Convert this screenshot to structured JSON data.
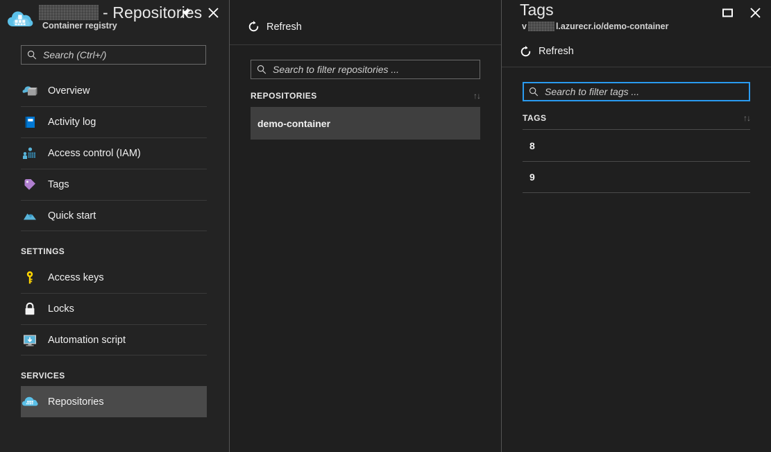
{
  "blade_menu": {
    "resource_icon": "container-registry-cloud-icon",
    "title_redacted": true,
    "title_suffix": "- Repositories",
    "subtitle": "Container registry",
    "actions": [
      {
        "name": "pin-button",
        "icon": "pin-icon"
      },
      {
        "name": "close-button",
        "icon": "close-icon"
      }
    ],
    "search": {
      "placeholder": "Search (Ctrl+/)",
      "value": "",
      "icon": "search-icon"
    },
    "items": [
      {
        "label": "Overview",
        "icon": "overview-icon",
        "selected": false
      },
      {
        "label": "Activity log",
        "icon": "activity-log-icon",
        "selected": false
      },
      {
        "label": "Access control (IAM)",
        "icon": "access-control-icon",
        "selected": false
      },
      {
        "label": "Tags",
        "icon": "tags-icon",
        "selected": false
      },
      {
        "label": "Quick start",
        "icon": "quick-start-icon",
        "selected": false
      }
    ],
    "groups": [
      {
        "label": "SETTINGS",
        "items": [
          {
            "label": "Access keys",
            "icon": "key-icon",
            "selected": false
          },
          {
            "label": "Locks",
            "icon": "lock-icon",
            "selected": false
          },
          {
            "label": "Automation script",
            "icon": "automation-script-icon",
            "selected": false
          }
        ]
      },
      {
        "label": "SERVICES",
        "items": [
          {
            "label": "Repositories",
            "icon": "repositories-icon",
            "selected": true
          }
        ]
      }
    ]
  },
  "blade_repos": {
    "refresh_label": "Refresh",
    "refresh_icon": "refresh-icon",
    "filter": {
      "placeholder": "Search to filter repositories ...",
      "value": "",
      "icon": "search-icon",
      "focused": false
    },
    "column_header": "REPOSITORIES",
    "sort_icon": "↑↓",
    "rows": [
      {
        "name": "demo-container",
        "selected": true
      }
    ]
  },
  "blade_tags": {
    "title": "Tags",
    "subtitle_prefix": "v",
    "subtitle_redacted": true,
    "subtitle_suffix": "l.azurecr.io/demo-container",
    "actions": [
      {
        "name": "maximize-button",
        "icon": "maximize-icon"
      },
      {
        "name": "close-button",
        "icon": "close-icon"
      }
    ],
    "refresh_label": "Refresh",
    "refresh_icon": "refresh-icon",
    "filter": {
      "placeholder": "Search to filter tags ...",
      "value": "",
      "icon": "search-icon",
      "focused": true
    },
    "column_header": "TAGS",
    "sort_icon": "↑↓",
    "rows": [
      {
        "name": "8"
      },
      {
        "name": "9"
      }
    ]
  },
  "colors": {
    "background": "#1f1f1f",
    "menu_background": "#232323",
    "selection": "#4a4a4a",
    "accent": "#2a9bf0",
    "divider": "#3a3a3a",
    "text": "#f0f0f0"
  }
}
